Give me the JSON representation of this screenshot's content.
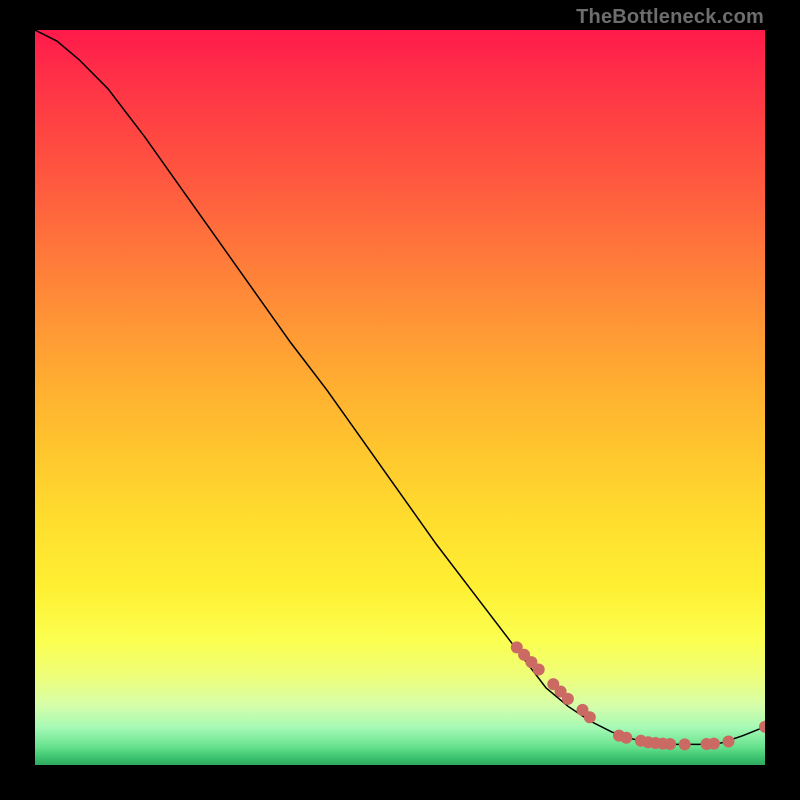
{
  "watermark": "TheBottleneck.com",
  "colors": {
    "background": "#000000",
    "curve": "#000000",
    "marker": "#cb6a62"
  },
  "chart_data": {
    "type": "line",
    "title": "",
    "xlabel": "",
    "ylabel": "",
    "xlim": [
      0,
      100
    ],
    "ylim": [
      0,
      100
    ],
    "grid": false,
    "legend": false,
    "series": [
      {
        "name": "curve",
        "x": [
          0,
          3,
          6,
          10,
          15,
          20,
          25,
          30,
          35,
          40,
          45,
          50,
          55,
          60,
          65,
          70,
          73,
          76,
          79,
          82,
          85,
          88,
          91,
          94,
          97,
          100
        ],
        "y": [
          100,
          98.5,
          96,
          92,
          85.5,
          78.5,
          71.5,
          64.5,
          57.5,
          51,
          44,
          37,
          30,
          23.5,
          17,
          10.5,
          8,
          6,
          4.5,
          3.5,
          3,
          2.8,
          2.8,
          3,
          4,
          5.2
        ]
      }
    ],
    "markers": [
      {
        "x": 66,
        "y": 16
      },
      {
        "x": 67,
        "y": 15
      },
      {
        "x": 68,
        "y": 14
      },
      {
        "x": 69,
        "y": 13
      },
      {
        "x": 71,
        "y": 11
      },
      {
        "x": 72,
        "y": 10
      },
      {
        "x": 73,
        "y": 9
      },
      {
        "x": 75,
        "y": 7.5
      },
      {
        "x": 76,
        "y": 6.5
      },
      {
        "x": 80,
        "y": 4
      },
      {
        "x": 81,
        "y": 3.7
      },
      {
        "x": 83,
        "y": 3.3
      },
      {
        "x": 84,
        "y": 3.1
      },
      {
        "x": 85,
        "y": 3.0
      },
      {
        "x": 86,
        "y": 2.9
      },
      {
        "x": 87,
        "y": 2.85
      },
      {
        "x": 89,
        "y": 2.8
      },
      {
        "x": 92,
        "y": 2.85
      },
      {
        "x": 93,
        "y": 2.9
      },
      {
        "x": 95,
        "y": 3.2
      },
      {
        "x": 100,
        "y": 5.2
      }
    ]
  }
}
